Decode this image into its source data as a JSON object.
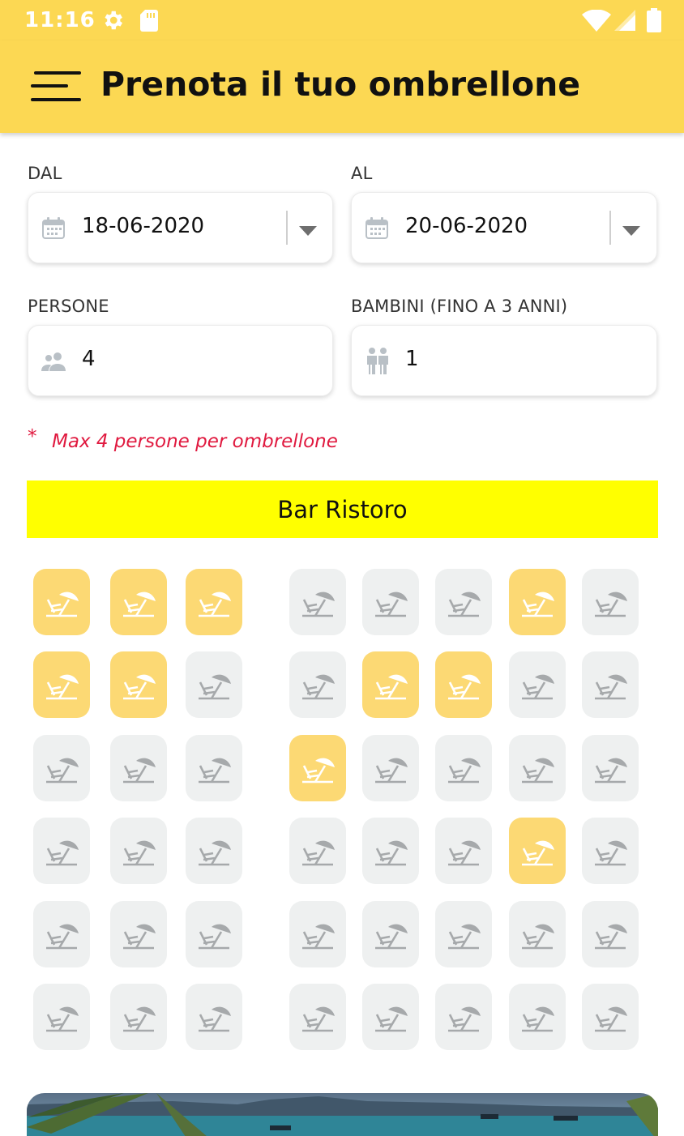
{
  "status_bar": {
    "time": "11:16",
    "icons": [
      "gear-icon",
      "sd-card-icon",
      "wifi-icon",
      "signal-icon",
      "battery-icon"
    ]
  },
  "app_bar": {
    "title": "Prenota il tuo ombrellone",
    "menu_icon": "hamburger-menu-icon"
  },
  "form": {
    "dal": {
      "label": "DAL",
      "value": "18-06-2020",
      "icon": "calendar-icon"
    },
    "al": {
      "label": "AL",
      "value": "20-06-2020",
      "icon": "calendar-icon"
    },
    "persone": {
      "label": "PERSONE",
      "value": "4",
      "icon": "people-icon"
    },
    "bambini": {
      "label": "BAMBINI (FINO A 3 ANNI)",
      "value": "1",
      "icon": "children-icon"
    }
  },
  "note": {
    "star": "*",
    "text": "Max 4 persone per ombrellone"
  },
  "bar_ristoro": {
    "label": "Bar Ristoro"
  },
  "umbrella_grid": {
    "icon": "beach-umbrella-icon",
    "left_block": [
      [
        true,
        true,
        true
      ],
      [
        true,
        true,
        false
      ],
      [
        false,
        false,
        false
      ],
      [
        false,
        false,
        false
      ],
      [
        false,
        false,
        false
      ],
      [
        false,
        false,
        false
      ]
    ],
    "right_block": [
      [
        false,
        false,
        false,
        true,
        false
      ],
      [
        false,
        true,
        true,
        false,
        false
      ],
      [
        true,
        false,
        false,
        false,
        false
      ],
      [
        false,
        false,
        false,
        true,
        false
      ],
      [
        false,
        false,
        false,
        false,
        false
      ],
      [
        false,
        false,
        false,
        false,
        false
      ]
    ]
  },
  "colors": {
    "header": "#fcd853",
    "selected_spot": "#fcd974",
    "free_spot": "#eef0f0",
    "bar_ristoro": "#ffff00",
    "note": "#e0193f"
  }
}
